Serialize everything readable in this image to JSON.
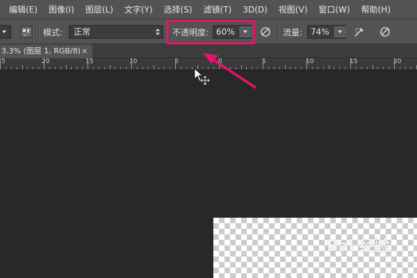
{
  "menu": [
    "编辑(E)",
    "图像(I)",
    "图层(L)",
    "文字(Y)",
    "选择(S)",
    "滤镜(T)",
    "3D(D)",
    "视图(V)",
    "窗口(W)",
    "帮助(H)"
  ],
  "options": {
    "mode_label": "模式:",
    "mode_value": "正常",
    "opacity_label": "不透明度:",
    "opacity_value": "60%",
    "flow_label": "流量:",
    "flow_value": "74%"
  },
  "document_tab": {
    "title": "3.3% (图层 1, RGB/8)",
    "close": "×"
  },
  "ruler": {
    "labels": [
      "5",
      "20",
      "15",
      "10",
      "5",
      "0",
      "5",
      "10",
      "15",
      "20"
    ]
  },
  "watermark": "Bai 经验",
  "colors": {
    "highlight": "#e8116b",
    "arrow": "#e8116b"
  }
}
